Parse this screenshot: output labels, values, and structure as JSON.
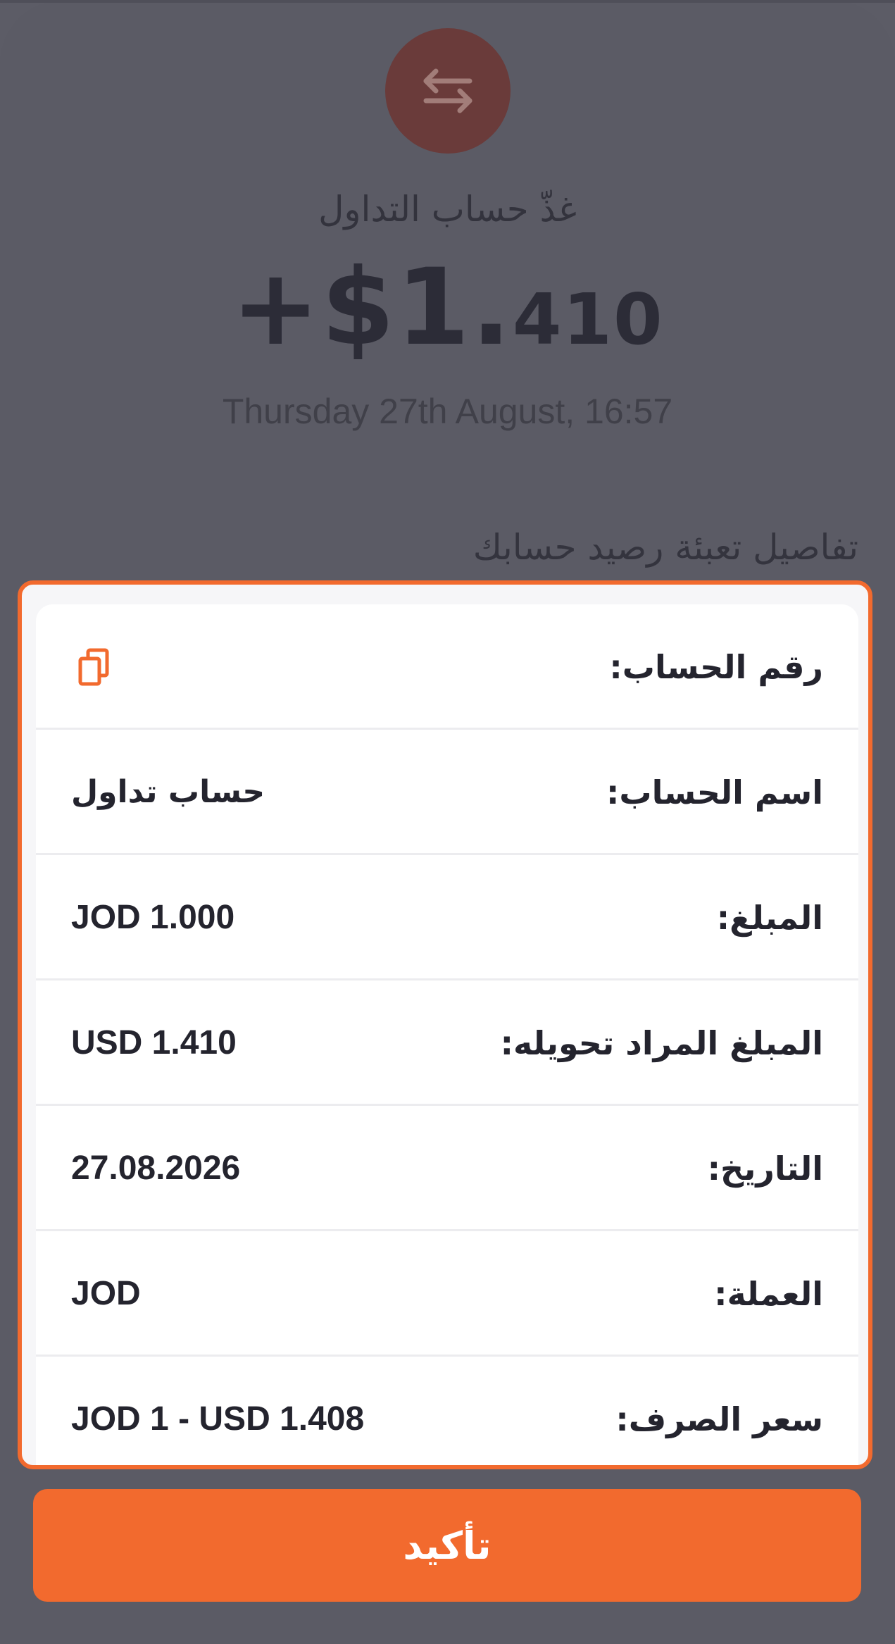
{
  "header": {
    "subtitle": "غذّ حساب التداول",
    "amount_main": "+$1.",
    "amount_fraction": "410",
    "datetime": "Thursday 27th August, 16:57"
  },
  "details": {
    "section_title": "تفاصيل تعبئة رصيد حسابك",
    "rows": [
      {
        "label": "رقم الحساب:",
        "value": ""
      },
      {
        "label": "اسم الحساب:",
        "value": "حساب تداول"
      },
      {
        "label": "المبلغ:",
        "value": "JOD 1.000"
      },
      {
        "label": "المبلغ المراد تحويله:",
        "value": "USD 1.410"
      },
      {
        "label": "التاريخ:",
        "value": "27.08.2026"
      },
      {
        "label": "العملة:",
        "value": "JOD"
      },
      {
        "label": "سعر الصرف:",
        "value": "JOD 1 - USD 1.408"
      }
    ]
  },
  "actions": {
    "confirm_label": "تأكيد"
  },
  "icons": {
    "top": "transfer-arrows-icon",
    "copy": "copy-icon"
  },
  "colors": {
    "accent": "#f26a2e",
    "overlay": "#5b5b65"
  }
}
